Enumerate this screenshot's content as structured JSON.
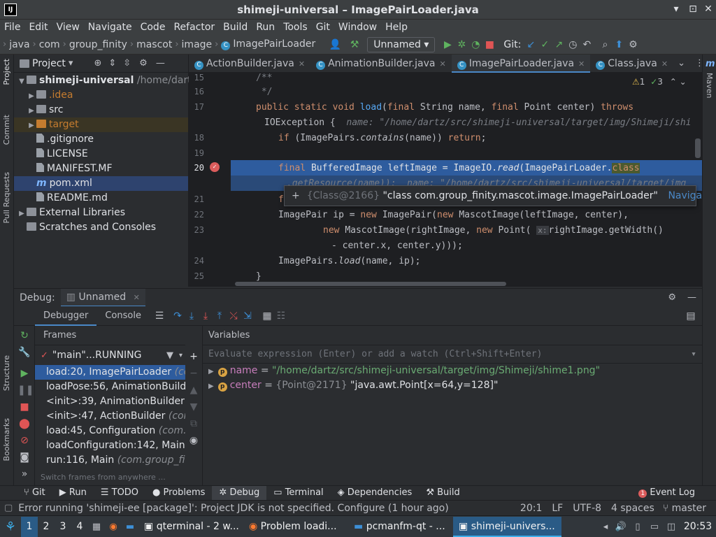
{
  "window": {
    "title": "shimeji-universal – ImagePairLoader.java"
  },
  "menu": [
    "File",
    "Edit",
    "View",
    "Navigate",
    "Code",
    "Refactor",
    "Build",
    "Run",
    "Tools",
    "Git",
    "Window",
    "Help"
  ],
  "breadcrumbs": [
    "java",
    "com",
    "group_finity",
    "mascot",
    "image",
    "ImagePairLoader"
  ],
  "toolbar": {
    "run_config": "Unnamed",
    "git_label": "Git:"
  },
  "left_strip": {
    "project": "Project",
    "commit": "Commit",
    "pull_requests": "Pull Requests",
    "structure": "Structure",
    "bookmarks": "Bookmarks"
  },
  "right_strip": {
    "maven": "Maven"
  },
  "project": {
    "header": "Project",
    "root_name": "shimeji-universal",
    "root_path": "/home/dartz",
    "items": [
      ".idea",
      "src",
      "target",
      ".gitignore",
      "LICENSE",
      "MANIFEST.MF",
      "pom.xml",
      "README.md"
    ],
    "external": "External Libraries",
    "scratches": "Scratches and Consoles"
  },
  "editor_tabs": [
    "ActionBuilder.java",
    "AnimationBuilder.java",
    "ImagePairLoader.java",
    "Class.java"
  ],
  "inspections": {
    "warnings": "1",
    "ok": "3"
  },
  "code": {
    "line_numbers": [
      "15",
      "16",
      "17",
      "18",
      "19",
      "20",
      "21",
      "22",
      "23",
      "24",
      "25"
    ],
    "l15": "/**",
    "l16": " */",
    "l17_a": "public static void ",
    "l17_b": "load",
    "l17_c": "(",
    "l17_d": "final ",
    "l17_e": "String name, ",
    "l17_f": "final ",
    "l17_g": "Point center) ",
    "l17_h": "throws",
    "l17w_a": "IOException {",
    "l17w_hint": "name: \"/home/dartz/src/shimeji-universal/target/img/Shimeji/shi",
    "l18_a": "if ",
    "l18_b": "(ImagePairs.",
    "l18_c": "contains",
    "l18_d": "(name)) ",
    "l18_e": "return",
    ";": ";",
    "l20_a": "final ",
    "l20_b": "BufferedImage leftImage = ImageIO.",
    "l20_c": "read",
    "l20_d": "(ImagePairLoader.",
    "l20_e": "class",
    "l20w": ".getResource(name));  name: \"/home/dartz/src/shimeji-universal/target/img",
    "l21": "f",
    "l22_a": "ImagePair ip = ",
    "l22_b": "new ",
    "l22_c": "ImagePair(",
    "l22_d": "new ",
    "l22_e": "MascotImage(leftImage, center),",
    "l23_a": "new ",
    "l23_b": "MascotImage(rightImage, ",
    "l23_c": "new ",
    "l23_d": "Point(",
    "l23_x": "x:",
    "l23_e": "rightImage.getWidth()",
    "l23w": "- center.x, center.y)));",
    "l24_a": "ImagePairs.",
    "l24_b": "load",
    "l24_c": "(name, ip);",
    "l25": "}"
  },
  "tooltip": {
    "ref": "{Class@2166}",
    "value": "\"class com.group_finity.mascot.image.ImagePairLoader\"",
    "navigate": "Navigate"
  },
  "debug": {
    "label": "Debug:",
    "config": "Unnamed",
    "tabs": [
      "Debugger",
      "Console"
    ],
    "frames_title": "Frames",
    "variables_title": "Variables",
    "thread": "\"main\"...RUNNING",
    "frames": [
      {
        "m": "load:20, ImagePairLoader",
        "c": "(com"
      },
      {
        "m": "loadPose:56, AnimationBuilder",
        "c": ""
      },
      {
        "m": "<init>:39, AnimationBuilder",
        "c": "(c"
      },
      {
        "m": "<init>:47, ActionBuilder",
        "c": "(com."
      },
      {
        "m": "load:45, Configuration",
        "c": "(com.gr"
      },
      {
        "m": "loadConfiguration:142, Main",
        "c": "(c"
      },
      {
        "m": "run:116, Main",
        "c": "(com.group_finit"
      }
    ],
    "switch_hint": "Switch frames from anywhere ...",
    "eval_placeholder": "Evaluate expression (Enter) or add a watch (Ctrl+Shift+Enter)",
    "vars": [
      {
        "name": "name",
        "eq": " = ",
        "ref": "",
        "value": "\"/home/dartz/src/shimeji-universal/target/img/Shimeji/shime1.png\""
      },
      {
        "name": "center",
        "eq": " = ",
        "ref": "{Point@2171} ",
        "value": "\"java.awt.Point[x=64,y=128]\""
      }
    ]
  },
  "toolwindows": [
    "Git",
    "Run",
    "TODO",
    "Problems",
    "Debug",
    "Terminal",
    "Dependencies",
    "Build"
  ],
  "event_log": "Event Log",
  "event_count": "1",
  "status": {
    "message": "Error running 'shimeji-ee [package]': Project JDK is not specified. Configure (1 hour ago)",
    "pos": "20:1",
    "le": "LF",
    "enc": "UTF-8",
    "indent": "4 spaces",
    "branch": "master"
  },
  "taskbar": {
    "desktops": [
      "1",
      "2",
      "3",
      "4"
    ],
    "tasks": [
      "qterminal - 2 w...",
      "Problem loadi...",
      "pcmanfm-qt - ...",
      "shimeji-univers..."
    ],
    "clock": "20:53"
  },
  "colors": {
    "accent": "#4a88c7",
    "selection": "#2e5c9e",
    "run_green": "#5fb35f",
    "stop_red": "#e05555"
  }
}
